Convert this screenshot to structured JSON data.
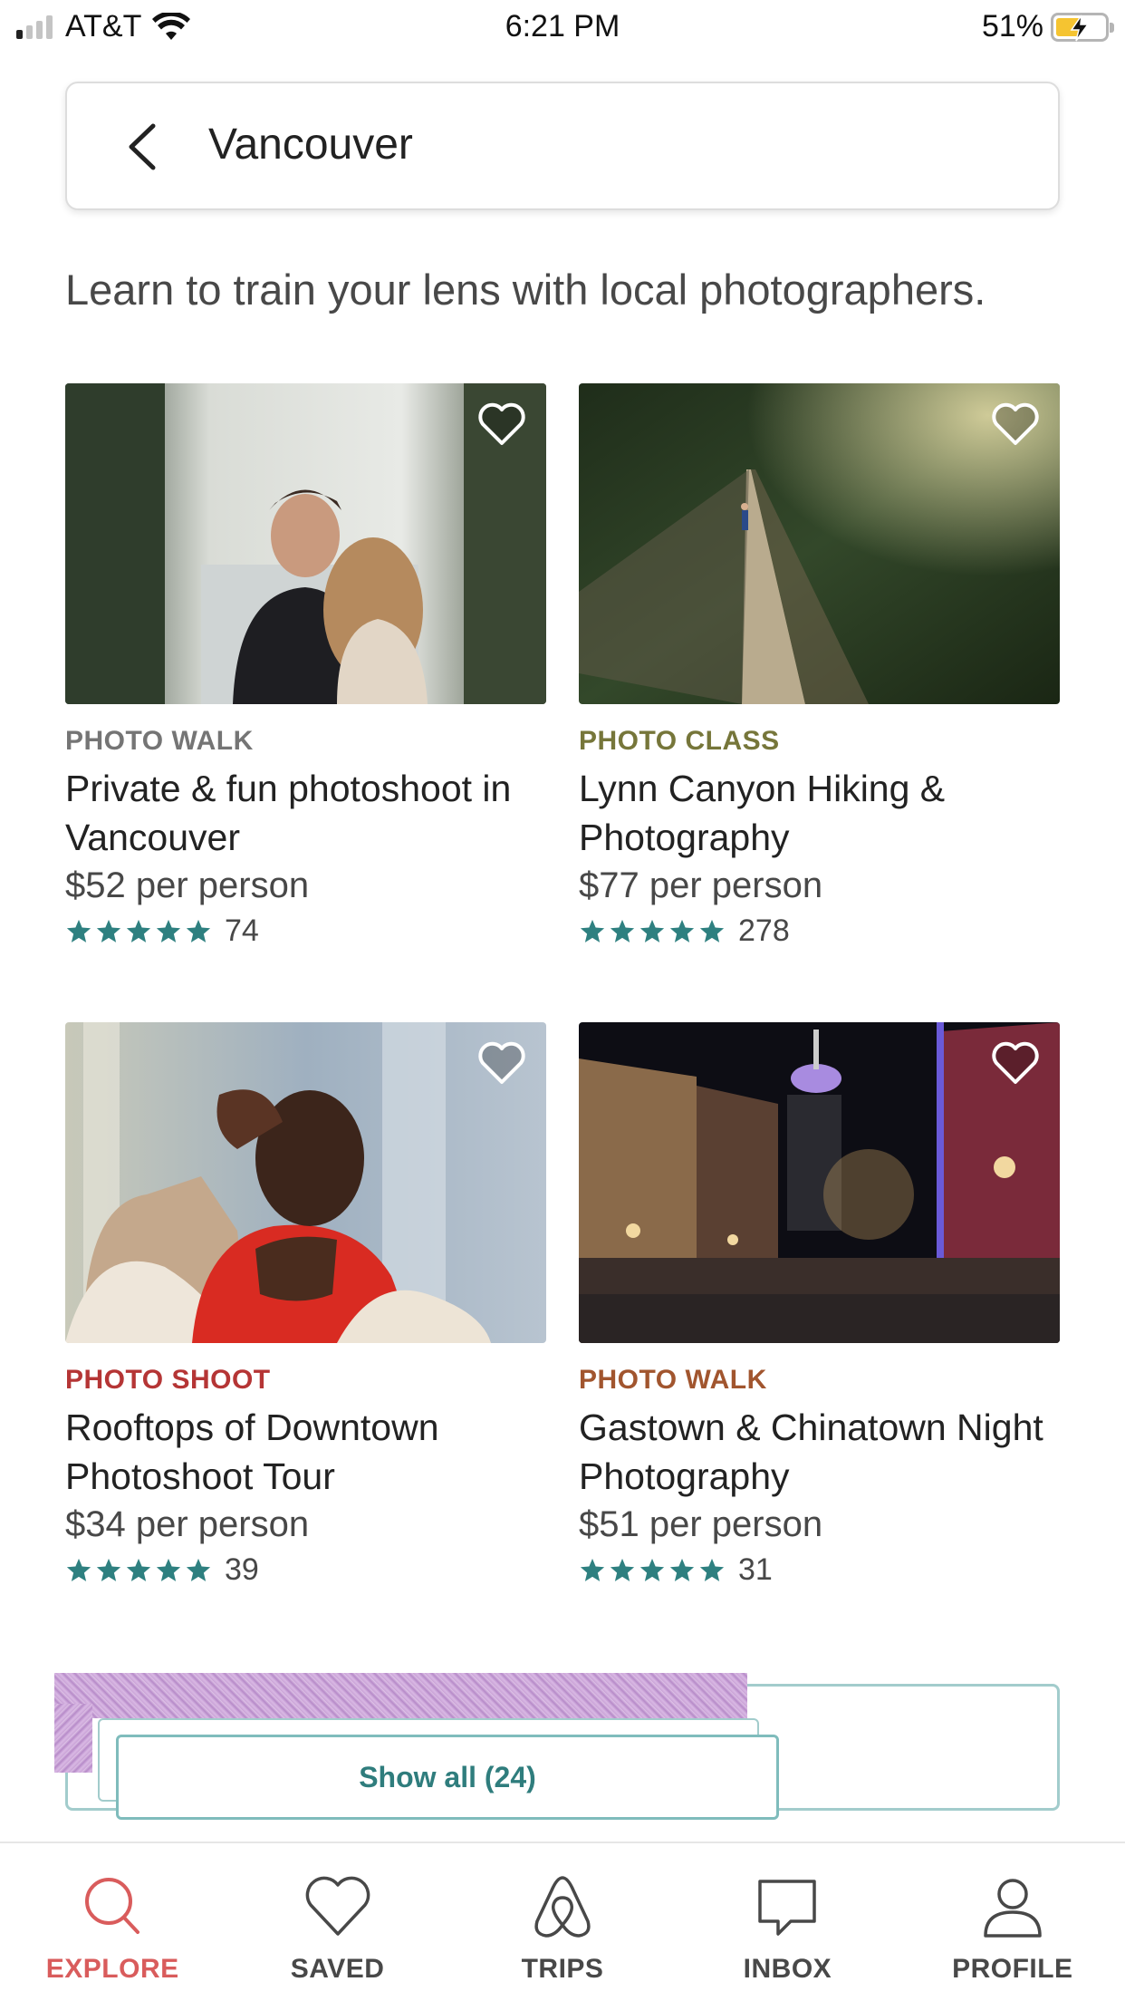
{
  "status_bar": {
    "carrier": "AT&T",
    "time": "6:21 PM",
    "battery": "51%",
    "battery_level": 0.51,
    "signal_bars_on": 1,
    "signal_bars_total": 4
  },
  "search": {
    "title": "Vancouver",
    "back_icon": "chevron-left-icon"
  },
  "subtitle": "Learn to train your lens with local photographers.",
  "colors": {
    "accent_teal": "#2d8181",
    "star_teal": "#2e8080",
    "active_tab": "#d95c5c"
  },
  "listings": [
    {
      "kind": "PHOTO WALK",
      "kind_color": "#757575",
      "title": "Private & fun photoshoot in Vancouver",
      "price": "$52 per person",
      "rating_count": "74",
      "stars": 5
    },
    {
      "kind": "PHOTO CLASS",
      "kind_color": "#76763a",
      "title": "Lynn Canyon Hiking & Photography",
      "price": "$77 per person",
      "rating_count": "278",
      "stars": 5
    },
    {
      "kind": "PHOTO SHOOT",
      "kind_color": "#b53535",
      "title": "Rooftops of Downtown Photoshoot Tour",
      "price": "$34 per person",
      "rating_count": "39",
      "stars": 5
    },
    {
      "kind": "PHOTO WALK",
      "kind_color": "#a1552e",
      "title": "Gastown & Chinatown Night Photography",
      "price": "$51 per person",
      "rating_count": "31",
      "stars": 5
    }
  ],
  "show_all": {
    "label": "Show all (24)"
  },
  "tabs": [
    {
      "label": "EXPLORE",
      "icon": "search-icon",
      "active": true
    },
    {
      "label": "SAVED",
      "icon": "heart-icon",
      "active": false
    },
    {
      "label": "TRIPS",
      "icon": "airbnb-logo-icon",
      "active": false
    },
    {
      "label": "INBOX",
      "icon": "chat-bubble-icon",
      "active": false
    },
    {
      "label": "PROFILE",
      "icon": "person-icon",
      "active": false
    }
  ]
}
